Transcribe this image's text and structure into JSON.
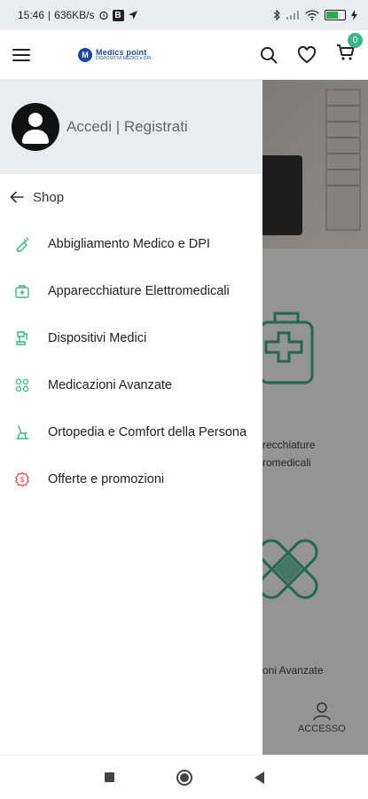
{
  "status_bar": {
    "time": "15:46",
    "speed": "636KB/s",
    "b_badge": "B"
  },
  "header": {
    "logo_text": "Medics point",
    "logo_subtext": "DISPOSITIVI MEDICI e DPI",
    "cart_count": "0"
  },
  "drawer": {
    "login_label": "Accedi | Registrati",
    "back_label": "Shop",
    "items": [
      {
        "label": "Abbigliamento Medico e DPI",
        "icon": "syringe-icon",
        "color": "#3db38a"
      },
      {
        "label": "Apparecchiature Elettromedicali",
        "icon": "medical-bag-icon",
        "color": "#3db38a"
      },
      {
        "label": "Dispositivi Medici",
        "icon": "device-icon",
        "color": "#3db38a"
      },
      {
        "label": "Medicazioni Avanzate",
        "icon": "bandage-icon",
        "color": "#3db38a"
      },
      {
        "label": "Ortopedia e Comfort della Persona",
        "icon": "orthopedic-icon",
        "color": "#3db38a"
      },
      {
        "label": "Offerte e promozioni",
        "icon": "offer-icon",
        "color": "#e0404a"
      }
    ]
  },
  "background": {
    "cat1_line1": "recchiature",
    "cat1_line2": "romedicali",
    "cat2_line1": "oni Avanzate",
    "account_label": "ACCESSO"
  },
  "colors": {
    "accent": "#3db38a",
    "drawer_header_bg": "#ebecee"
  }
}
